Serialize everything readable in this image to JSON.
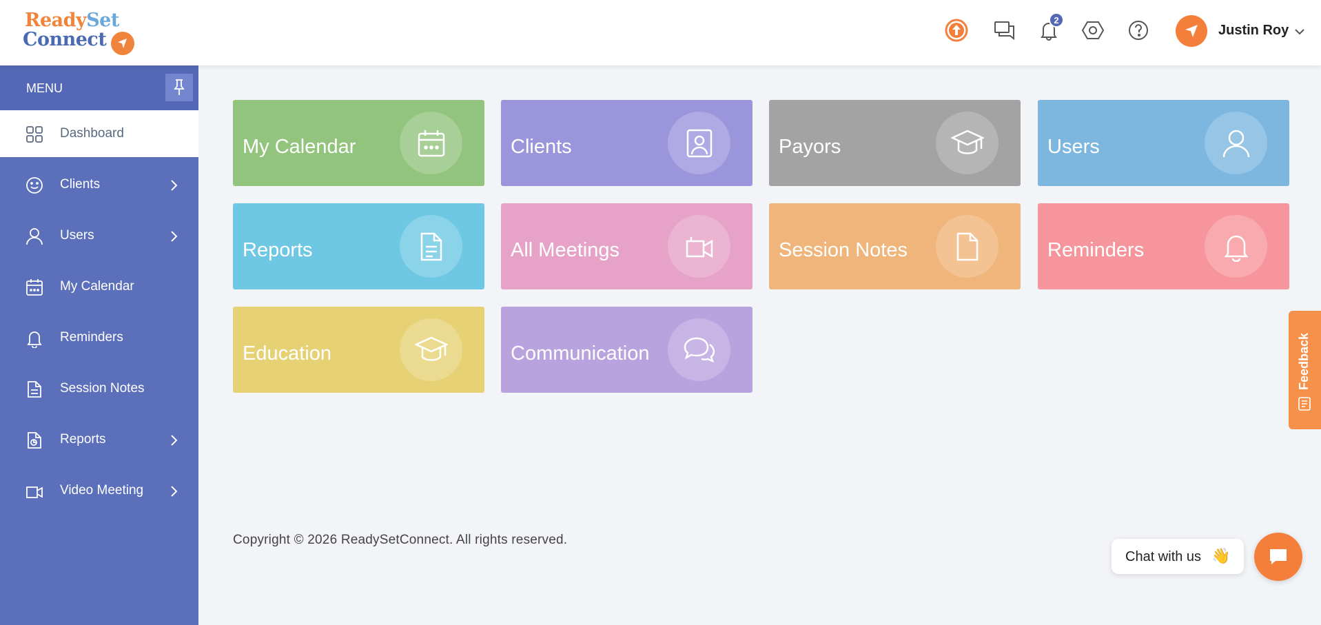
{
  "header": {
    "logo": {
      "word1": "Ready",
      "word2": "Set",
      "word3": "Connect"
    },
    "notifications_count": "2",
    "user_name": "Justin Roy",
    "icons": [
      "upgrade-icon",
      "messages-icon",
      "bell-icon",
      "settings-icon",
      "help-icon",
      "chevron-down-icon"
    ]
  },
  "sidebar": {
    "menu_label": "MENU",
    "items": [
      {
        "label": "Dashboard",
        "icon": "grid-icon",
        "active": true
      },
      {
        "label": "Clients",
        "icon": "smile-icon",
        "has_submenu": true
      },
      {
        "label": "Users",
        "icon": "user-icon",
        "has_submenu": true
      },
      {
        "label": "My Calendar",
        "icon": "calendar-icon"
      },
      {
        "label": "Reminders",
        "icon": "bell-icon"
      },
      {
        "label": "Session Notes",
        "icon": "document-icon"
      },
      {
        "label": "Reports",
        "icon": "report-icon",
        "has_submenu": true
      },
      {
        "label": "Video Meeting",
        "icon": "video-icon",
        "has_submenu": true
      }
    ]
  },
  "tiles": [
    {
      "label": "My Calendar",
      "color": "#93c47d",
      "icon": "calendar-icon"
    },
    {
      "label": "Clients",
      "color": "#9b95dc",
      "icon": "contact-icon"
    },
    {
      "label": "Payors",
      "color": "#a3a3a3",
      "icon": "graduation-cap-icon"
    },
    {
      "label": "Users",
      "color": "#7db7e0",
      "icon": "user-icon"
    },
    {
      "label": "Reports",
      "color": "#6ec8e4",
      "icon": "document-icon"
    },
    {
      "label": "All Meetings",
      "color": "#e6a3c7",
      "icon": "video-icon"
    },
    {
      "label": "Session Notes",
      "color": "#f0b57a",
      "icon": "file-icon"
    },
    {
      "label": "Reminders",
      "color": "#f7959c",
      "icon": "bell-icon"
    },
    {
      "label": "Education",
      "color": "#e6d275",
      "icon": "graduation-cap-icon"
    },
    {
      "label": "Communication",
      "color": "#b9a3df",
      "icon": "chat-bubbles-icon"
    }
  ],
  "footer": {
    "copyright": "Copyright © 2026 ReadySetConnect. All rights reserved."
  },
  "feedback": {
    "label": "Feedback"
  },
  "chat": {
    "label": "Chat with us",
    "emoji": "👋"
  },
  "colors": {
    "sidebar": "#5b6fba",
    "accent": "#f47f3a",
    "background": "#f2f4f7"
  }
}
